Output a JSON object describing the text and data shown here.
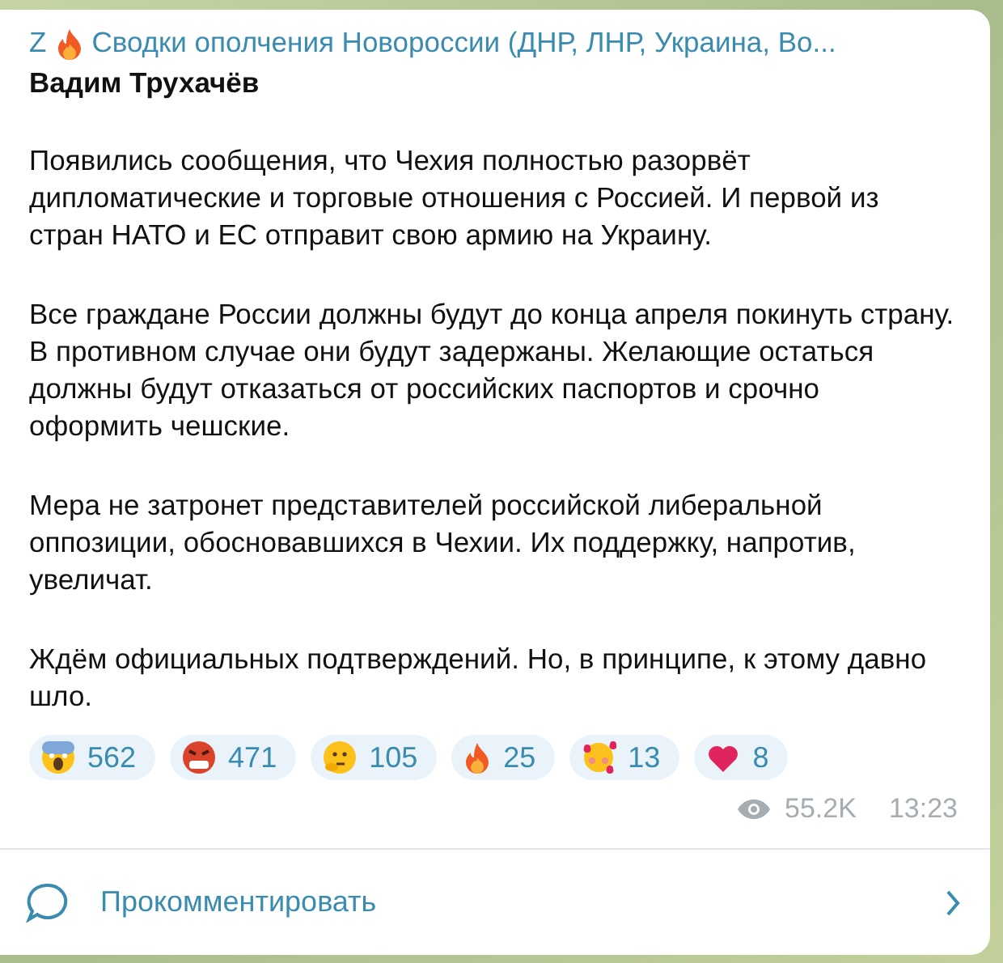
{
  "channel": {
    "prefix": "Z",
    "name": "Сводки ополчения Новороссии (ДНР, ЛНР, Украина, Во..."
  },
  "author": "Вадим Трухачёв",
  "paragraphs": [
    "Появились сообщения, что Чехия полностью разорвёт дипломатические и торговые отношения с Россией. И первой из стран НАТО и ЕС отправит свою армию на Украину.",
    "Все граждане России должны будут до конца апреля покинуть страну. В противном случае они будут задержаны. Желающие остаться должны будут отказаться от российских паспортов и срочно оформить чешские.",
    "Мера не затронет представителей российской либеральной оппозиции, обосновавшихся в Чехии. Их поддержку, напротив, увеличат.",
    "Ждём официальных подтверждений. Но, в принципе, к этому давно шло."
  ],
  "reactions": [
    {
      "kind": "scream",
      "count": "562"
    },
    {
      "kind": "angry",
      "count": "471"
    },
    {
      "kind": "thinking",
      "count": "105"
    },
    {
      "kind": "fire",
      "count": "25"
    },
    {
      "kind": "hearts",
      "count": "13"
    },
    {
      "kind": "heart",
      "count": "8"
    }
  ],
  "views": "55.2K",
  "time": "13:23",
  "comment": {
    "label": "Прокомментировать"
  }
}
